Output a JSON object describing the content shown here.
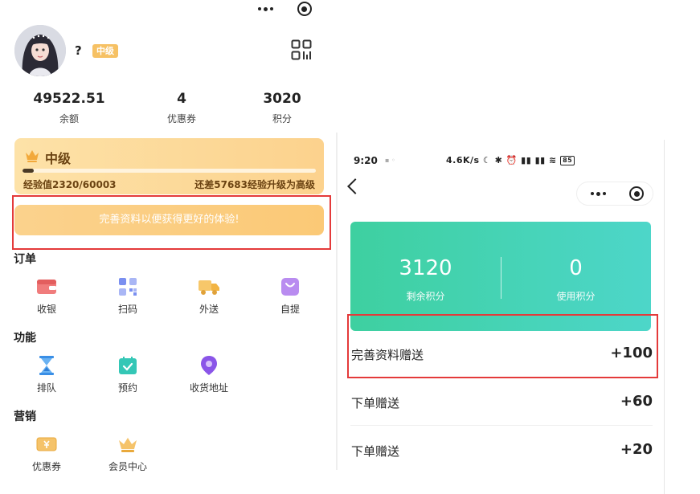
{
  "left": {
    "user": {
      "name": "?",
      "level_badge": "中级"
    },
    "stats": [
      {
        "value": "49522.51",
        "label": "余额"
      },
      {
        "value": "4",
        "label": "优惠券"
      },
      {
        "value": "3020",
        "label": "积分"
      }
    ],
    "vip": {
      "title": "中级",
      "progress_fraction": 0.0387,
      "exp_text": "经验值2320/60003",
      "next_text": "还差57683经验升级为高级"
    },
    "promo_text": "完善资料以便获得更好的体验!",
    "sections": {
      "orders": {
        "title": "订单",
        "items": [
          {
            "label": "收银",
            "icon": "cashier-wallet-icon"
          },
          {
            "label": "扫码",
            "icon": "qr-scan-icon"
          },
          {
            "label": "外送",
            "icon": "delivery-truck-icon"
          },
          {
            "label": "自提",
            "icon": "shopping-bag-icon"
          }
        ]
      },
      "functions": {
        "title": "功能",
        "items": [
          {
            "label": "排队",
            "icon": "hourglass-icon"
          },
          {
            "label": "预约",
            "icon": "calendar-check-icon"
          },
          {
            "label": "收货地址",
            "icon": "location-pin-icon"
          }
        ]
      },
      "marketing": {
        "title": "营销",
        "items": [
          {
            "label": "优惠券",
            "icon": "coupon-ticket-icon"
          },
          {
            "label": "会员中心",
            "icon": "crown-icon"
          }
        ]
      }
    }
  },
  "right": {
    "status_bar": {
      "time": "9:20",
      "network_speed": "4.6K/s",
      "battery": "85"
    },
    "points": {
      "remaining": {
        "value": "3120",
        "label": "剩余积分"
      },
      "used": {
        "value": "0",
        "label": "使用积分"
      }
    },
    "records": [
      {
        "label": "完善资料赠送",
        "value": "+100"
      },
      {
        "label": "下单赠送",
        "value": "+60"
      },
      {
        "label": "下单赠送",
        "value": "+20"
      }
    ]
  },
  "colors": {
    "highlight_red": "#e43a3a",
    "gold_text": "#6b4312",
    "points_green": "#3ed0a0",
    "level_badge": "#f6c164"
  }
}
